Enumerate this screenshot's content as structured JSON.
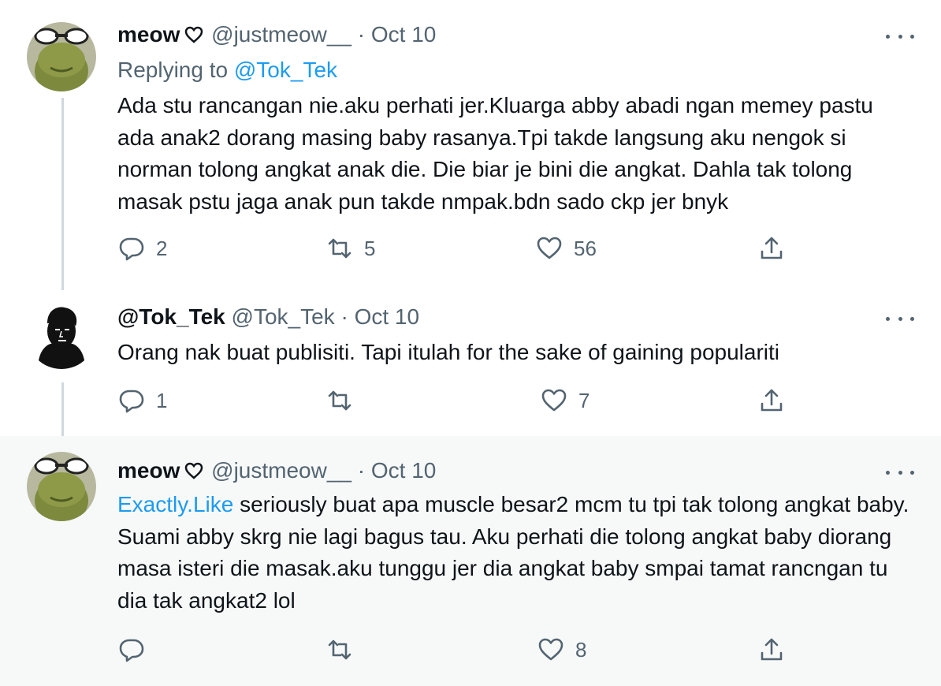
{
  "tweets": [
    {
      "display_name": "meow",
      "handle": "@justmeow__",
      "date": "Oct 10",
      "replying_label": "Replying to",
      "replying_mention": "@Tok_Tek",
      "text": "Ada stu rancangan nie.aku perhati jer.Kluarga abby abadi ngan memey pastu ada anak2 dorang masing baby rasanya.Tpi takde langsung aku nengok si norman tolong angkat anak die. Die biar je bini die angkat. Dahla tak tolong masak pstu jaga anak pun takde nmpak.bdn sado ckp jer bnyk",
      "replies": "2",
      "retweets": "5",
      "likes": "56"
    },
    {
      "display_name": "@Tok_Tek",
      "handle": "@Tok_Tek",
      "date": "Oct 10",
      "text": "Orang nak buat publisiti. Tapi itulah for the sake of gaining populariti",
      "replies": "1",
      "retweets": "",
      "likes": "7"
    },
    {
      "display_name": "meow",
      "handle": "@justmeow__",
      "date": "Oct 10",
      "link_text": "Exactly.Like",
      "text": " seriously buat apa muscle besar2 mcm tu tpi tak tolong angkat baby. Suami abby skrg nie lagi bagus tau. Aku perhati die tolong angkat baby diorang masa isteri die masak.aku tunggu jer dia angkat baby smpai tamat rancngan tu dia tak angkat2 lol",
      "replies": "",
      "retweets": "",
      "likes": "8"
    }
  ],
  "separator": "·",
  "colors": {
    "accent": "#1d9bf0",
    "muted": "#536471",
    "text": "#0f1419",
    "highlight_bg": "#f7f9f9"
  },
  "icons": [
    "heart-outline-icon",
    "reply-icon",
    "retweet-icon",
    "like-icon",
    "share-icon",
    "more-icon"
  ]
}
